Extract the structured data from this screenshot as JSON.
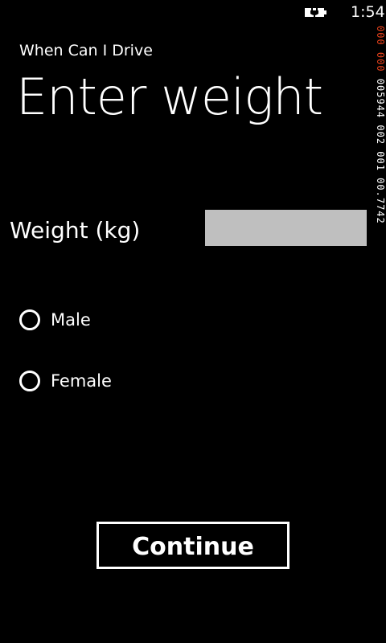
{
  "status_bar": {
    "time": "1:54",
    "battery_icon": "battery-charging-icon"
  },
  "counters": {
    "red_text": "000 000",
    "white_text": "005944 002 001 00.7742"
  },
  "app": {
    "title": "When Can I Drive"
  },
  "page": {
    "title": "Enter weight"
  },
  "form": {
    "weight_label": "Weight (kg)",
    "weight_value": "",
    "weight_placeholder": "",
    "gender_options": [
      {
        "label": "Male",
        "selected": false
      },
      {
        "label": "Female",
        "selected": false
      }
    ]
  },
  "actions": {
    "continue_label": "Continue"
  },
  "colors": {
    "background": "#000000",
    "foreground": "#ffffff",
    "input_background": "#bfbfbf",
    "counter_red": "#e8421c"
  }
}
